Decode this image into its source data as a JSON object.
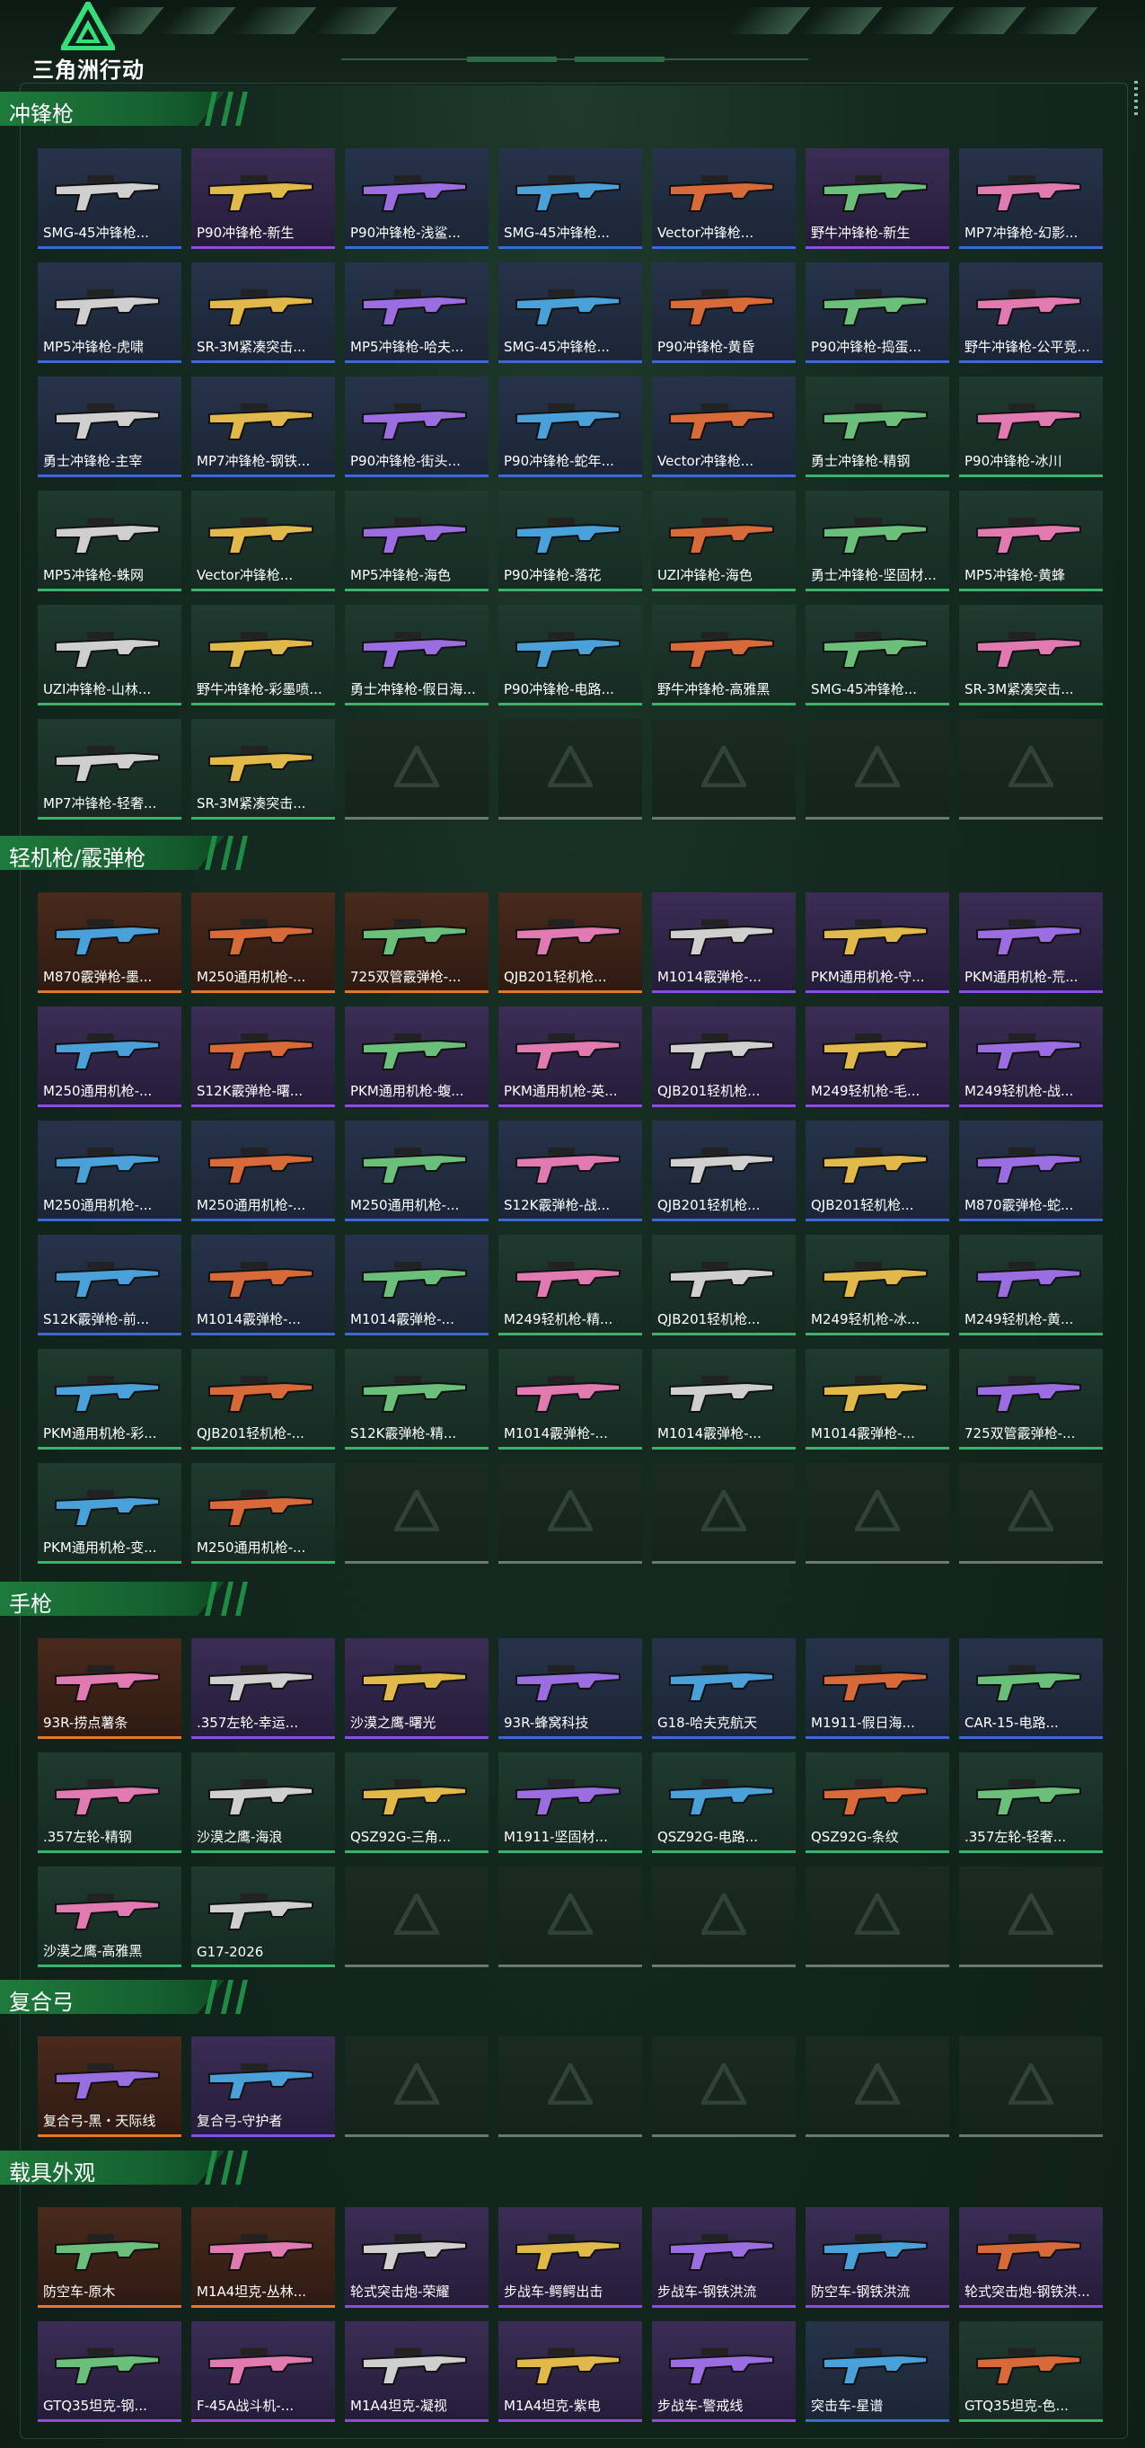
{
  "app": {
    "logo_text": "三角洲行动"
  },
  "theme": {
    "accent": "#1d7a3c",
    "purple": "#8c4ee0",
    "blue": "#3a6ad6",
    "green": "#3bb36a",
    "orange": "#e07a2a"
  },
  "sections": [
    {
      "title": "冲锋枪",
      "items": [
        {
          "label": "SMG-45冲锋枪...",
          "rarity": "blue"
        },
        {
          "label": "P90冲锋枪-新生",
          "rarity": "purple"
        },
        {
          "label": "P90冲锋枪-浅鲨...",
          "rarity": "blue"
        },
        {
          "label": "SMG-45冲锋枪...",
          "rarity": "blue"
        },
        {
          "label": "Vector冲锋枪...",
          "rarity": "blue"
        },
        {
          "label": "野牛冲锋枪-新生",
          "rarity": "purple"
        },
        {
          "label": "MP7冲锋枪-幻影...",
          "rarity": "blue"
        },
        {
          "label": "MP5冲锋枪-虎啸",
          "rarity": "blue"
        },
        {
          "label": "SR-3M紧凑突击...",
          "rarity": "blue"
        },
        {
          "label": "MP5冲锋枪-哈夫...",
          "rarity": "blue"
        },
        {
          "label": "SMG-45冲锋枪...",
          "rarity": "blue"
        },
        {
          "label": "P90冲锋枪-黄昏",
          "rarity": "blue"
        },
        {
          "label": "P90冲锋枪-捣蛋...",
          "rarity": "blue"
        },
        {
          "label": "野牛冲锋枪-公平竞...",
          "rarity": "blue"
        },
        {
          "label": "勇士冲锋枪-主宰",
          "rarity": "blue"
        },
        {
          "label": "MP7冲锋枪-钢铁...",
          "rarity": "blue"
        },
        {
          "label": "P90冲锋枪-街头...",
          "rarity": "blue"
        },
        {
          "label": "P90冲锋枪-蛇年...",
          "rarity": "blue"
        },
        {
          "label": "Vector冲锋枪...",
          "rarity": "blue"
        },
        {
          "label": "勇士冲锋枪-精钢",
          "rarity": "green"
        },
        {
          "label": "P90冲锋枪-冰川",
          "rarity": "green"
        },
        {
          "label": "MP5冲锋枪-蛛网",
          "rarity": "green"
        },
        {
          "label": "Vector冲锋枪...",
          "rarity": "green"
        },
        {
          "label": "MP5冲锋枪-海色",
          "rarity": "green"
        },
        {
          "label": "P90冲锋枪-落花",
          "rarity": "green"
        },
        {
          "label": "UZI冲锋枪-海色",
          "rarity": "green"
        },
        {
          "label": "勇士冲锋枪-坚固材...",
          "rarity": "green"
        },
        {
          "label": "MP5冲锋枪-黄蜂",
          "rarity": "green"
        },
        {
          "label": "UZI冲锋枪-山林...",
          "rarity": "green"
        },
        {
          "label": "野牛冲锋枪-彩墨喷...",
          "rarity": "green"
        },
        {
          "label": "勇士冲锋枪-假日海...",
          "rarity": "green"
        },
        {
          "label": "P90冲锋枪-电路...",
          "rarity": "green"
        },
        {
          "label": "野牛冲锋枪-高雅黑",
          "rarity": "green"
        },
        {
          "label": "SMG-45冲锋枪...",
          "rarity": "green"
        },
        {
          "label": "SR-3M紧凑突击...",
          "rarity": "green"
        },
        {
          "label": "MP7冲锋枪-轻奢...",
          "rarity": "green"
        },
        {
          "label": "SR-3M紧凑突击...",
          "rarity": "green"
        }
      ],
      "empty_count": 5
    },
    {
      "title": "轻机枪/霰弹枪",
      "items": [
        {
          "label": "M870霰弹枪-墨...",
          "rarity": "orange"
        },
        {
          "label": "M250通用机枪-...",
          "rarity": "orange"
        },
        {
          "label": "725双管霰弹枪-...",
          "rarity": "orange"
        },
        {
          "label": "QJB201轻机枪...",
          "rarity": "orange"
        },
        {
          "label": "M1014霰弹枪-...",
          "rarity": "purple"
        },
        {
          "label": "PKM通用机枪-守...",
          "rarity": "purple"
        },
        {
          "label": "PKM通用机枪-荒...",
          "rarity": "purple"
        },
        {
          "label": "M250通用机枪-...",
          "rarity": "purple"
        },
        {
          "label": "S12K霰弹枪-曙...",
          "rarity": "purple"
        },
        {
          "label": "PKM通用机枪-蝮...",
          "rarity": "purple"
        },
        {
          "label": "PKM通用机枪-英...",
          "rarity": "purple"
        },
        {
          "label": "QJB201轻机枪...",
          "rarity": "purple"
        },
        {
          "label": "M249轻机枪-毛...",
          "rarity": "purple"
        },
        {
          "label": "M249轻机枪-战...",
          "rarity": "purple"
        },
        {
          "label": "M250通用机枪-...",
          "rarity": "blue"
        },
        {
          "label": "M250通用机枪-...",
          "rarity": "blue"
        },
        {
          "label": "M250通用机枪-...",
          "rarity": "blue"
        },
        {
          "label": "S12K霰弹枪-战...",
          "rarity": "blue"
        },
        {
          "label": "QJB201轻机枪...",
          "rarity": "blue"
        },
        {
          "label": "QJB201轻机枪...",
          "rarity": "blue"
        },
        {
          "label": "M870霰弹枪-蛇...",
          "rarity": "blue"
        },
        {
          "label": "S12K霰弹枪-前...",
          "rarity": "blue"
        },
        {
          "label": "M1014霰弹枪-...",
          "rarity": "blue"
        },
        {
          "label": "M1014霰弹枪-...",
          "rarity": "blue"
        },
        {
          "label": "M249轻机枪-精...",
          "rarity": "green"
        },
        {
          "label": "QJB201轻机枪...",
          "rarity": "green"
        },
        {
          "label": "M249轻机枪-冰...",
          "rarity": "green"
        },
        {
          "label": "M249轻机枪-黄...",
          "rarity": "green"
        },
        {
          "label": "PKM通用机枪-彩...",
          "rarity": "green"
        },
        {
          "label": "QJB201轻机枪-...",
          "rarity": "green"
        },
        {
          "label": "S12K霰弹枪-精...",
          "rarity": "green"
        },
        {
          "label": "M1014霰弹枪-...",
          "rarity": "green"
        },
        {
          "label": "M1014霰弹枪-...",
          "rarity": "green"
        },
        {
          "label": "M1014霰弹枪-...",
          "rarity": "green"
        },
        {
          "label": "725双管霰弹枪-...",
          "rarity": "green"
        },
        {
          "label": "PKM通用机枪-变...",
          "rarity": "green"
        },
        {
          "label": "M250通用机枪-...",
          "rarity": "green"
        }
      ],
      "empty_count": 5
    },
    {
      "title": "手枪",
      "items": [
        {
          "label": "93R-捞点薯条",
          "rarity": "orange"
        },
        {
          "label": ".357左轮-幸运...",
          "rarity": "purple"
        },
        {
          "label": "沙漠之鹰-曙光",
          "rarity": "purple"
        },
        {
          "label": "93R-蜂窝科技",
          "rarity": "blue"
        },
        {
          "label": "G18-哈夫克航天",
          "rarity": "blue"
        },
        {
          "label": "M1911-假日海...",
          "rarity": "blue"
        },
        {
          "label": "CAR-15-电路...",
          "rarity": "blue"
        },
        {
          "label": ".357左轮-精钢",
          "rarity": "green"
        },
        {
          "label": "沙漠之鹰-海浪",
          "rarity": "green"
        },
        {
          "label": "QSZ92G-三角...",
          "rarity": "green"
        },
        {
          "label": "M1911-坚固材...",
          "rarity": "green"
        },
        {
          "label": "QSZ92G-电路...",
          "rarity": "green"
        },
        {
          "label": "QSZ92G-条纹",
          "rarity": "green"
        },
        {
          "label": ".357左轮-轻奢...",
          "rarity": "green"
        },
        {
          "label": "沙漠之鹰-高雅黑",
          "rarity": "green"
        },
        {
          "label": "G17-2026",
          "rarity": "green"
        }
      ],
      "empty_count": 5
    },
    {
      "title": "复合弓",
      "items": [
        {
          "label": "复合弓-黑・天际线",
          "rarity": "orange"
        },
        {
          "label": "复合弓-守护者",
          "rarity": "purple"
        }
      ],
      "empty_count": 5
    },
    {
      "title": "载具外观",
      "items": [
        {
          "label": "防空车-原木",
          "rarity": "orange"
        },
        {
          "label": "M1A4坦克-丛林...",
          "rarity": "orange"
        },
        {
          "label": "轮式突击炮-荣耀",
          "rarity": "purple"
        },
        {
          "label": "步战车-鳄鳄出击",
          "rarity": "purple"
        },
        {
          "label": "步战车-钢铁洪流",
          "rarity": "purple"
        },
        {
          "label": "防空车-钢铁洪流",
          "rarity": "purple"
        },
        {
          "label": "轮式突击炮-钢铁洪...",
          "rarity": "purple"
        },
        {
          "label": "GTQ35坦克-钢...",
          "rarity": "purple"
        },
        {
          "label": "F-45A战斗机-...",
          "rarity": "purple"
        },
        {
          "label": "M1A4坦克-凝视",
          "rarity": "purple"
        },
        {
          "label": "M1A4坦克-紫电",
          "rarity": "purple"
        },
        {
          "label": "步战车-警戒线",
          "rarity": "purple"
        },
        {
          "label": "突击车-星谱",
          "rarity": "blue"
        },
        {
          "label": "GTQ35坦克-色...",
          "rarity": "green"
        }
      ],
      "empty_count": 0
    }
  ]
}
